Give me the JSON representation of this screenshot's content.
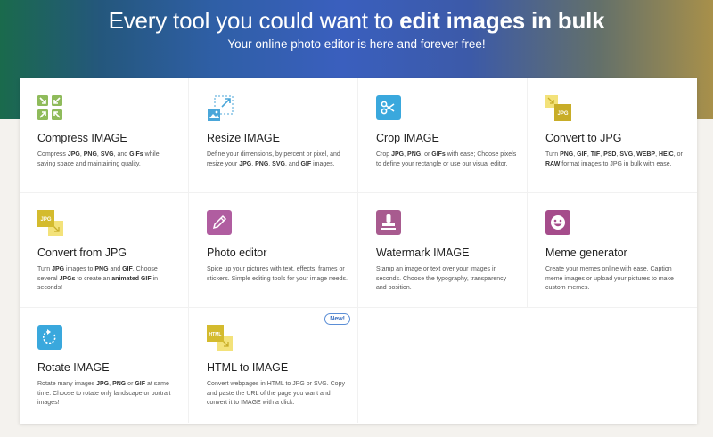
{
  "hero": {
    "title_pre": "Every tool you could want to ",
    "title_bold": "edit images in bulk",
    "subtitle": "Your online photo editor is here and forever free!"
  },
  "tools": [
    {
      "title": "Compress IMAGE",
      "icon": "compress-icon",
      "color": "#8fbb5b",
      "desc": [
        [
          "Compress ",
          ""
        ],
        [
          "JPG",
          "b"
        ],
        [
          ", ",
          ""
        ],
        [
          "PNG",
          "b"
        ],
        [
          ", ",
          ""
        ],
        [
          "SVG",
          "b"
        ],
        [
          ", and ",
          ""
        ],
        [
          "GIFs",
          "b"
        ],
        [
          " while saving space and maintaining quality.",
          ""
        ]
      ]
    },
    {
      "title": "Resize IMAGE",
      "icon": "resize-icon",
      "color": "#4aa6d9",
      "desc": [
        [
          "Define your dimensions, by percent or pixel, and resize your ",
          ""
        ],
        [
          "JPG",
          "b"
        ],
        [
          ", ",
          ""
        ],
        [
          "PNG",
          "b"
        ],
        [
          ", ",
          ""
        ],
        [
          "SVG",
          "b"
        ],
        [
          ", and ",
          ""
        ],
        [
          "GIF",
          "b"
        ],
        [
          " images.",
          ""
        ]
      ]
    },
    {
      "title": "Crop IMAGE",
      "icon": "scissors-icon",
      "color": "#3aa8dd",
      "desc": [
        [
          "Crop ",
          ""
        ],
        [
          "JPG",
          "b"
        ],
        [
          ", ",
          ""
        ],
        [
          "PNG",
          "b"
        ],
        [
          ", or ",
          ""
        ],
        [
          "GIFs",
          "b"
        ],
        [
          " with ease; Choose pixels to define your rectangle or use our visual editor.",
          ""
        ]
      ]
    },
    {
      "title": "Convert to JPG",
      "icon": "convert-to-jpg-icon",
      "color": "#c8ad28",
      "desc": [
        [
          "Turn ",
          ""
        ],
        [
          "PNG",
          "b"
        ],
        [
          ", ",
          ""
        ],
        [
          "GIF",
          "b"
        ],
        [
          ", ",
          ""
        ],
        [
          "TIF",
          "b"
        ],
        [
          ", ",
          ""
        ],
        [
          "PSD",
          "b"
        ],
        [
          ", ",
          ""
        ],
        [
          "SVG",
          "b"
        ],
        [
          ", ",
          ""
        ],
        [
          "WEBP",
          "b"
        ],
        [
          ", ",
          ""
        ],
        [
          "HEIC",
          "b"
        ],
        [
          ", or ",
          ""
        ],
        [
          "RAW",
          "b"
        ],
        [
          " format images to JPG in bulk with ease.",
          ""
        ]
      ]
    },
    {
      "title": "Convert from JPG",
      "icon": "convert-from-jpg-icon",
      "color": "#d4bb2e",
      "desc": [
        [
          "Turn ",
          ""
        ],
        [
          "JPG",
          "b"
        ],
        [
          " images to ",
          ""
        ],
        [
          "PNG",
          "b"
        ],
        [
          " and ",
          ""
        ],
        [
          "GIF",
          "b"
        ],
        [
          ". Choose several ",
          ""
        ],
        [
          "JPGs",
          "b"
        ],
        [
          " to create an ",
          ""
        ],
        [
          "animated GIF",
          "b"
        ],
        [
          " in seconds!",
          ""
        ]
      ]
    },
    {
      "title": "Photo editor",
      "icon": "pencil-icon",
      "color": "#b05da0",
      "desc": [
        [
          "Spice up your pictures with text, effects, frames or stickers. Simple editing tools for your image needs.",
          ""
        ]
      ]
    },
    {
      "title": "Watermark IMAGE",
      "icon": "stamp-icon",
      "color": "#a85b8f",
      "desc": [
        [
          "Stamp an image or text over your images in seconds. Choose the typography, transparency and position.",
          ""
        ]
      ]
    },
    {
      "title": "Meme generator",
      "icon": "meme-face-icon",
      "color": "#a54c8b",
      "desc": [
        [
          "Create your memes online with ease. Caption meme images or upload your pictures to make custom memes.",
          ""
        ]
      ]
    },
    {
      "title": "Rotate IMAGE",
      "icon": "rotate-icon",
      "color": "#3aa8dd",
      "desc": [
        [
          "Rotate many images ",
          ""
        ],
        [
          "JPG",
          "b"
        ],
        [
          ", ",
          ""
        ],
        [
          "PNG",
          "b"
        ],
        [
          " or ",
          ""
        ],
        [
          "GIF",
          "b"
        ],
        [
          " at same time. Choose to rotate only landscape or portrait images!",
          ""
        ]
      ]
    },
    {
      "title": "HTML to IMAGE",
      "icon": "html-to-image-icon",
      "color": "#d4bb2e",
      "badge": "New!",
      "desc": [
        [
          "Convert webpages in HTML to JPG or SVG. Copy and paste the URL of the page you want and convert it to IMAGE with a click.",
          ""
        ]
      ]
    }
  ],
  "icon_labels": {
    "jpg": "JPG",
    "html": "HTML"
  }
}
